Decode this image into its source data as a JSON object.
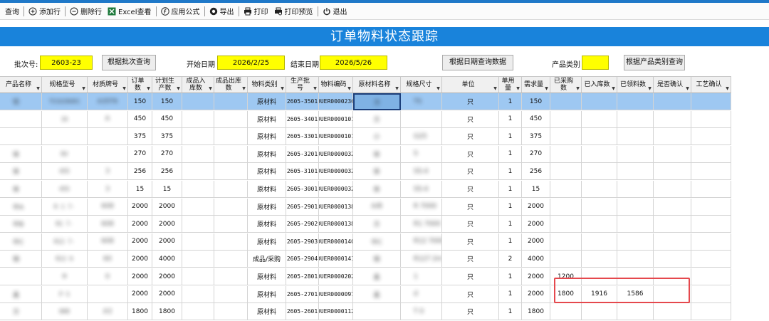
{
  "toolbar": {
    "items": [
      {
        "label": "查询",
        "icon": "none"
      },
      {
        "label": "添加行",
        "icon": "plus-circle-icon"
      },
      {
        "label": "删除行",
        "icon": "minus-circle-icon"
      },
      {
        "label": "Excel查看",
        "icon": "excel-icon"
      },
      {
        "label": "应用公式",
        "icon": "formula-icon"
      },
      {
        "label": "导出",
        "icon": "export-icon"
      },
      {
        "label": "打印",
        "icon": "printer-icon"
      },
      {
        "label": "打印预览",
        "icon": "print-preview-icon"
      },
      {
        "label": "退出",
        "icon": "power-icon"
      }
    ]
  },
  "form": {
    "title": "订单物料状态跟踪",
    "batch_label": "批次号:",
    "batch_value": "2603-23",
    "query_batch_button": "根据批次查询",
    "start_date_label": "开始日期",
    "start_date_value": "2026/2/25",
    "end_date_label": "结束日期",
    "end_date_value": "2026/5/26",
    "query_date_button": "根据日期查询数据",
    "category_label": "产品类别",
    "category_value": "",
    "query_category_button": "根据产品类别查询"
  },
  "colors": {
    "accent": "#1983db",
    "input_highlight": "#ffff00",
    "selection": "#9ec8f2",
    "annotation": "#e5484d"
  },
  "table": {
    "headers": [
      "产品名称",
      "规格型号",
      "材质牌号",
      "订单数",
      "计划生产数",
      "成品入库数",
      "成品出库数",
      "物料类别",
      "生产批号",
      "物料编码",
      "原材料名称",
      "规格尺寸",
      "单位",
      "单用量",
      "需求量",
      "已采购数",
      "已入库数",
      "已领料数",
      "是否确认",
      "工艺确认"
    ],
    "rows": [
      [
        "铝",
        "TS1U20U01",
        "A35T6",
        "150",
        "150",
        "",
        "",
        "原材料",
        "2605-3501",
        "DUER0000236",
        "方",
        "TS",
        "只",
        "1",
        "150",
        "",
        "",
        "",
        "",
        ""
      ],
      [
        "",
        "16",
        "A",
        "450",
        "450",
        "",
        "",
        "原材料",
        "2605-3401",
        "DUER0000101",
        "方",
        "",
        "只",
        "1",
        "450",
        "",
        "",
        "",
        "",
        ""
      ],
      [
        "",
        "",
        "",
        "375",
        "375",
        "",
        "",
        "原材料",
        "2605-3301",
        "DUER0000101",
        "小",
        "G25",
        "只",
        "1",
        "375",
        "",
        "",
        "",
        "",
        ""
      ],
      [
        "体",
        "RV",
        "",
        "270",
        "270",
        "",
        "",
        "原材料",
        "2605-3201",
        "DUER0000032",
        "体",
        "S",
        "只",
        "1",
        "270",
        "",
        "",
        "",
        "",
        ""
      ],
      [
        "体",
        "455",
        "3",
        "256",
        "256",
        "",
        "",
        "原材料",
        "2605-3101",
        "DUER0000032",
        "体",
        "SS-4",
        "只",
        "1",
        "256",
        "",
        "",
        "",
        "",
        ""
      ],
      [
        "体",
        "455",
        "3",
        "15",
        "15",
        "",
        "",
        "原材料",
        "2605-3001",
        "DUER0000032",
        "体",
        "SS-4",
        "只",
        "1",
        "15",
        "",
        "",
        "",
        "",
        ""
      ],
      [
        "中A",
        "R 1 7-",
        "608",
        "2000",
        "2000",
        "",
        "",
        "原材料",
        "2605-2901",
        "DUER0000138",
        "A/B",
        "R 7000",
        "只",
        "1",
        "2000",
        "",
        "",
        "",
        "",
        ""
      ],
      [
        "中B",
        "R1 7-",
        "608",
        "2000",
        "2000",
        "",
        "",
        "原材料",
        "2605-2902",
        "DUER0000138",
        "方",
        "R1 7000",
        "只",
        "1",
        "2000",
        "",
        "",
        "",
        "",
        ""
      ],
      [
        "中C",
        "R12 7-",
        "608",
        "2000",
        "2000",
        "",
        "",
        "原材料",
        "2605-2903",
        "DUER0000140",
        "中C",
        "R12 7000",
        "只",
        "1",
        "2000",
        "",
        "",
        "",
        "",
        ""
      ],
      [
        "销",
        "R12 6",
        "60",
        "2000",
        "4000",
        "",
        "",
        "成品/采购",
        "2605-2904",
        "DUER0000141",
        "销",
        "R127 2m",
        "只",
        "2",
        "4000",
        "",
        "",
        "",
        "",
        ""
      ],
      [
        "",
        "M",
        "0",
        "2000",
        "2000",
        "",
        "",
        "原材料",
        "2605-2801",
        "DUER0000202",
        "盖",
        "1",
        "只",
        "1",
        "2000",
        "1200",
        "",
        "",
        "",
        ""
      ],
      [
        "盖",
        "P S",
        "",
        "2000",
        "2000",
        "",
        "",
        "原材料",
        "2605-2701",
        "DUER0000097",
        "盖",
        "d",
        "只",
        "1",
        "2000",
        "1800",
        "1916",
        "1586",
        "",
        ""
      ],
      [
        "方",
        "000",
        "A3",
        "1800",
        "1800",
        "",
        "",
        "原材料",
        "2605-2601",
        "DUER0000112",
        "",
        "T 0",
        "只",
        "1",
        "1800",
        "",
        "",
        "",
        "",
        ""
      ]
    ]
  }
}
